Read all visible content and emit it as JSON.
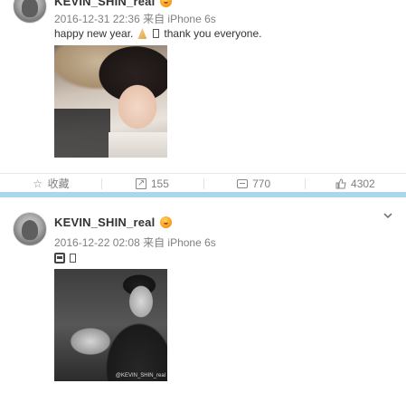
{
  "posts": [
    {
      "username": "KEVIN_SHIN_real",
      "meta": "2016-12-31 22:36 来自 iPhone 6s",
      "text_start": "happy new year.",
      "text_end": "thank you everyone.",
      "actions": {
        "favorite": "收藏",
        "forward": "155",
        "comment": "770",
        "like": "4302"
      }
    },
    {
      "username": "KEVIN_SHIN_real",
      "meta": "2016-12-22 02:08 来自 iPhone 6s",
      "watermark": "@KEVIN_SHIN_real"
    }
  ],
  "icons": {
    "favorite": "star-icon",
    "forward": "forward-icon",
    "comment": "comment-icon",
    "like": "thumbs-up-icon",
    "menu": "chevron-down-icon",
    "emoji_1": "praying-hands-icon",
    "emoji_2": "bus-icon",
    "verified": "verified-badge-icon"
  },
  "colors": {
    "separator": "#a9d7ec",
    "meta_text": "#808080"
  }
}
